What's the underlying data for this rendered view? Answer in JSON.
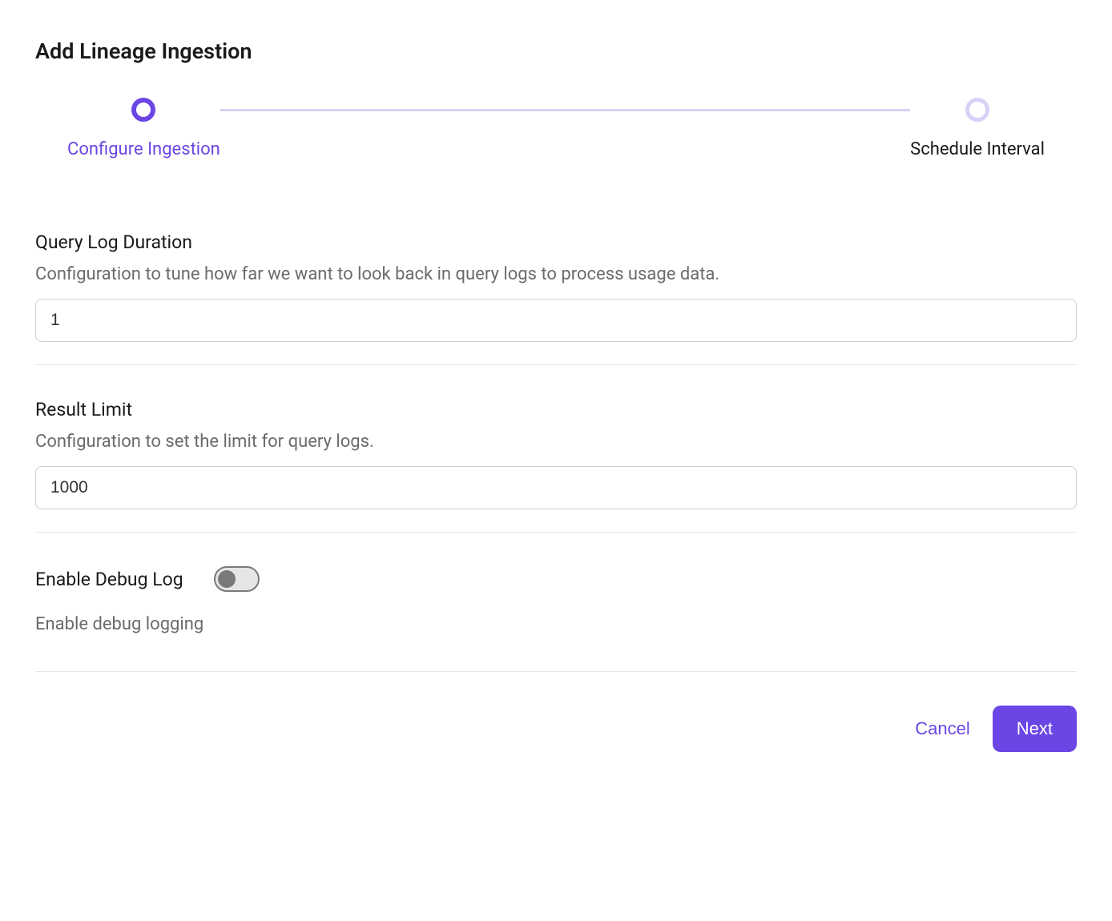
{
  "page": {
    "title": "Add Lineage Ingestion"
  },
  "stepper": {
    "steps": [
      {
        "label": "Configure Ingestion",
        "active": true
      },
      {
        "label": "Schedule Interval",
        "active": false
      }
    ]
  },
  "form": {
    "queryLogDuration": {
      "label": "Query Log Duration",
      "description": "Configuration to tune how far we want to look back in query logs to process usage data.",
      "value": "1"
    },
    "resultLimit": {
      "label": "Result Limit",
      "description": "Configuration to set the limit for query logs.",
      "value": "1000"
    },
    "enableDebugLog": {
      "label": "Enable Debug Log",
      "description": "Enable debug logging",
      "checked": false
    }
  },
  "buttons": {
    "cancel": "Cancel",
    "next": "Next"
  }
}
